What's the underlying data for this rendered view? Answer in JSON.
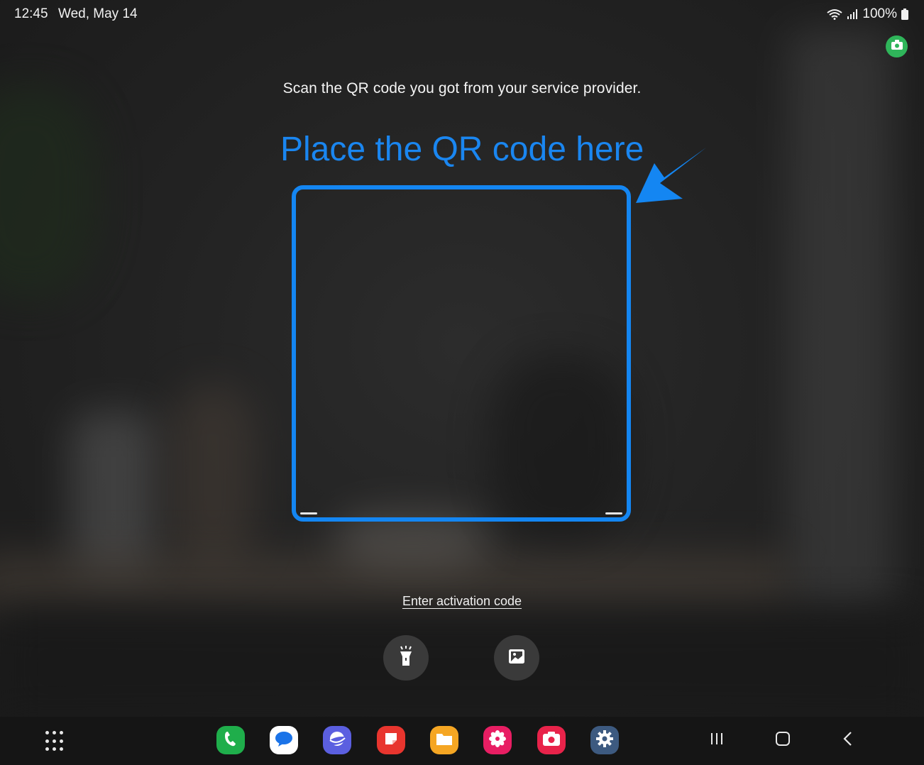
{
  "status_bar": {
    "time": "12:45",
    "date": "Wed, May 14",
    "battery": "100%",
    "icons": [
      "wifi-icon",
      "signal-icon",
      "battery-icon"
    ]
  },
  "camera_indicator": {
    "icon": "camera-icon",
    "color": "#2fb55a"
  },
  "main": {
    "instruction": "Scan the QR code you got from your service provider.",
    "annotation_label": "Place the QR code here",
    "annotation_color": "#1486f2",
    "activation_link": "Enter activation code",
    "buttons": [
      {
        "name": "flashlight",
        "icon": "flashlight-icon"
      },
      {
        "name": "gallery",
        "icon": "image-icon"
      }
    ]
  },
  "taskbar": {
    "app_drawer_icon": "grid-icon",
    "apps": [
      {
        "name": "phone",
        "icon": "phone-icon",
        "color": "#1fae4b"
      },
      {
        "name": "messages",
        "icon": "message-icon",
        "color": "#ffffff"
      },
      {
        "name": "internet",
        "icon": "browser-icon",
        "color": "#5b5fe0"
      },
      {
        "name": "notes",
        "icon": "notes-icon",
        "color": "#e8352e"
      },
      {
        "name": "files",
        "icon": "folder-icon",
        "color": "#f5a623"
      },
      {
        "name": "gallery",
        "icon": "flower-icon",
        "color": "#e81e63"
      },
      {
        "name": "screen-recorder",
        "icon": "camera-icon",
        "color": "#e8234a"
      },
      {
        "name": "settings",
        "icon": "gear-icon",
        "color": "#3d5a80"
      }
    ],
    "nav": [
      "recents-icon",
      "home-icon",
      "back-icon"
    ]
  }
}
